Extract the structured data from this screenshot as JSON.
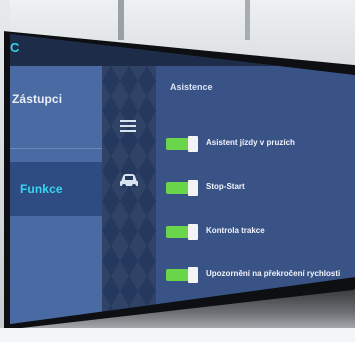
{
  "header": {
    "letter": "C"
  },
  "menu": {
    "items": [
      {
        "label": "Zástupci"
      },
      {
        "label": "Funkce"
      }
    ],
    "selected": "Funkce"
  },
  "icons": {
    "menu": "hamburger-icon",
    "vehicle": "car-icon"
  },
  "panel": {
    "title": "Asistence",
    "rows": [
      {
        "label": "Asistent jízdy v pruzích",
        "enabled": true
      },
      {
        "label": "Stop-Start",
        "enabled": true
      },
      {
        "label": "Kontrola trakce",
        "enabled": true
      },
      {
        "label": "Upozornění na překročení rychlosti",
        "enabled": true
      }
    ]
  },
  "colors": {
    "accent_cyan": "#35d6ef",
    "toggle_on": "#69d64a",
    "panel_bg": "#3a5387",
    "menu_bg": "#4a6aa3"
  }
}
